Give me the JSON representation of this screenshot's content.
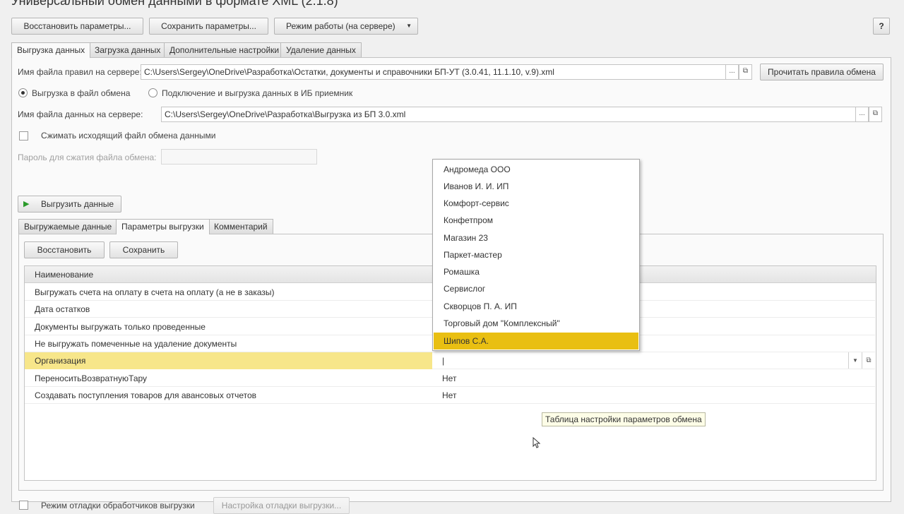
{
  "window": {
    "title": "Универсальный обмен данными в формате XML (2.1.8)"
  },
  "toolbar": {
    "restore_params": "Восстановить параметры...",
    "save_params": "Сохранить параметры...",
    "mode": "Режим работы (на сервере)",
    "help": "?"
  },
  "main_tabs": [
    "Выгрузка данных",
    "Загрузка данных",
    "Дополнительные настройки",
    "Удаление данных"
  ],
  "rules": {
    "label": "Имя файла правил на сервере:",
    "value": "C:\\Users\\Sergey\\OneDrive\\Разработка\\Остатки, документы и справочники БП-УТ (3.0.41, 11.1.10, v.9).xml",
    "choose": "...",
    "read_button": "Прочитать правила обмена"
  },
  "mode_radio": {
    "to_file": "Выгрузка в файл обмена",
    "to_ib": "Подключение и выгрузка данных в ИБ приемник",
    "selected": "to_file"
  },
  "data_file": {
    "label": "Имя файла данных на сервере:",
    "value": "C:\\Users\\Sergey\\OneDrive\\Разработка\\Выгрузка из БП 3.0.xml",
    "choose": "..."
  },
  "compress": {
    "label": "Сжимать исходящий файл обмена данными",
    "checked": false
  },
  "password": {
    "label": "Пароль для сжатия файла обмена:",
    "value": ""
  },
  "export_button": "Выгрузить данные",
  "sub_tabs": [
    "Выгружаемые данные",
    "Параметры выгрузки",
    "Комментарий"
  ],
  "params_toolbar": {
    "restore": "Восстановить",
    "save": "Сохранить"
  },
  "grid": {
    "header_name": "Наименование",
    "rows": [
      {
        "name": "Выгружать счета на оплату в счета на оплату (а не в заказы)",
        "value": ""
      },
      {
        "name": "Дата остатков",
        "value": ""
      },
      {
        "name": "Документы выгружать только проведенные",
        "value": ""
      },
      {
        "name": "Не выгружать помеченные на удаление документы",
        "value": ""
      },
      {
        "name": "Организация",
        "value": "|"
      },
      {
        "name": "ПереноситьВозвратнуюТару",
        "value": "Нет"
      },
      {
        "name": "Создавать поступления товаров для авансовых отчетов",
        "value": "Нет"
      }
    ]
  },
  "dropdown": {
    "items": [
      "Андромеда ООО",
      "Иванов И. И. ИП",
      "Комфорт-сервис",
      "Конфетпром",
      "Магазин 23",
      "Паркет-мастер",
      "Ромашка",
      "Сервислог",
      "Скворцов П. А. ИП",
      "Торговый дом \"Комплексный\"",
      "Шипов С.А."
    ],
    "selected_index": 10
  },
  "tooltip": "Таблица настройки параметров обмена",
  "debug": {
    "label": "Режим отладки обработчиков выгрузки",
    "button": "Настройка отладки выгрузки..."
  },
  "colors": {
    "selection": "#e9bf12",
    "row_highlight": "#f7e68a",
    "tooltip_bg": "#fdfde7"
  }
}
